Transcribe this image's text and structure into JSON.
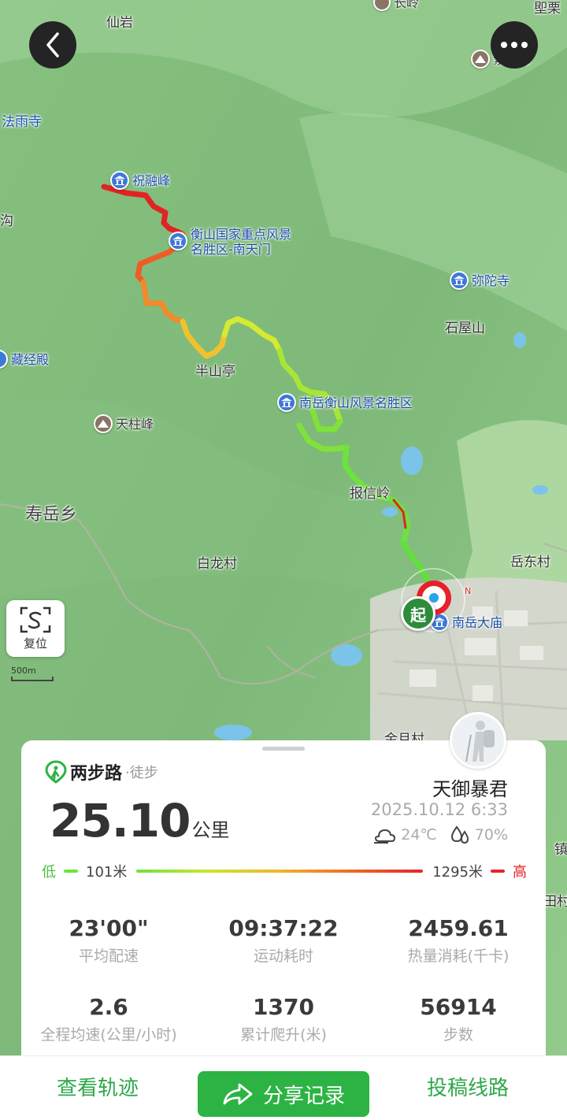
{
  "map": {
    "labels": {
      "xianyan": "仙岩",
      "changling": "长岭",
      "lixi": "堲栗",
      "ziguifeng": "紫盖峰",
      "fayusi": "法雨寺",
      "zhurongfeng": "祝融峰",
      "gou": "沟",
      "nantianmen": "衡山国家重点风景\n名胜区-南天门",
      "mituosi": "弥陀寺",
      "shiwushan": "石屋山",
      "cangjingdian": "藏经殿",
      "banshanting": "半山亭",
      "hengshan": "南岳衡山风景名胜区",
      "tianzhufeng": "天柱峰",
      "shouyuexiang": "寿岳乡",
      "baoxinling": "报信岭",
      "bailongcun": "白龙村",
      "yuedongcun": "岳东村",
      "nanyuedamiao": "南岳大庙",
      "jin": "镇",
      "tian": "田村",
      "jinyuecun": "金月村"
    },
    "reset_label": "复位",
    "scale_label": "500m",
    "start_label": "起",
    "north_label": "N"
  },
  "card": {
    "brand_name": "两步路",
    "brand_type": "·徒步",
    "distance_value": "25.10",
    "distance_unit": "公里",
    "username": "天御暴君",
    "datetime": "2025.10.12 6:33",
    "temperature": "24℃",
    "humidity": "70%",
    "elevation": {
      "low_label": "低",
      "low_value": "101米",
      "high_value": "1295米",
      "high_label": "高"
    },
    "stats": [
      {
        "value": "23'00\"",
        "label": "平均配速"
      },
      {
        "value": "09:37:22",
        "label": "运动耗时"
      },
      {
        "value": "2459.61",
        "label": "热量消耗(千卡)"
      },
      {
        "value": "2.6",
        "label": "全程均速(公里/小时)"
      },
      {
        "value": "1370",
        "label": "累计爬升(米)"
      },
      {
        "value": "56914",
        "label": "步数"
      }
    ]
  },
  "actions": {
    "view_track": "查看轨迹",
    "share": "分享记录",
    "submit_route": "投稿线路"
  },
  "colors": {
    "accent": "#2cb344",
    "track_low": "#6de33d",
    "track_high": "#e4262a"
  }
}
